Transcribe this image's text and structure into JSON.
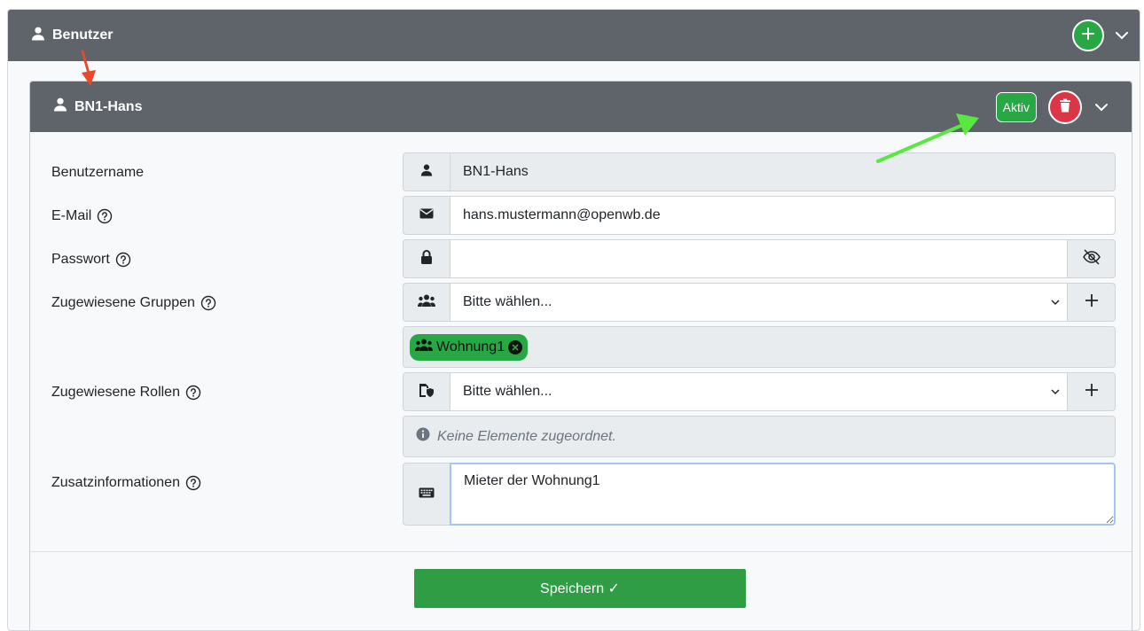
{
  "outer_header": {
    "title": "Benutzer",
    "icon": "user-icon",
    "add_icon": "plus-icon",
    "collapse_icon": "chevron-down-icon"
  },
  "inner_header": {
    "title": "BN1-Hans",
    "icon": "user-icon",
    "status_badge": "Aktiv",
    "delete_icon": "trash-icon",
    "collapse_icon": "chevron-down-icon"
  },
  "form": {
    "username": {
      "label": "Benutzername",
      "value": "BN1-Hans",
      "icon": "user-icon"
    },
    "email": {
      "label": "E-Mail",
      "value": "hans.mustermann@openwb.de",
      "icon": "envelope-icon"
    },
    "password": {
      "label": "Passwort",
      "value": "",
      "icon": "lock-icon",
      "toggle_icon": "eye-slash-icon"
    },
    "groups": {
      "label": "Zugewiesene Gruppen",
      "placeholder": "Bitte wählen...",
      "icon": "users-icon",
      "selected": [
        "Wohnung1"
      ]
    },
    "roles": {
      "label": "Zugewiesene Rollen",
      "placeholder": "Bitte wählen...",
      "icon": "user-shield-icon",
      "empty_text": "Keine Elemente zugeordnet."
    },
    "extra": {
      "label": "Zusatzinformationen",
      "value": "Mieter der Wohnung1",
      "icon": "keyboard-icon"
    }
  },
  "save_button": {
    "label": "Speichern ✓"
  },
  "colors": {
    "header_bg": "#5f646a",
    "success": "#28a745",
    "danger": "#dc3545",
    "annotation_red": "#e8492c",
    "annotation_green": "#58e83f"
  }
}
